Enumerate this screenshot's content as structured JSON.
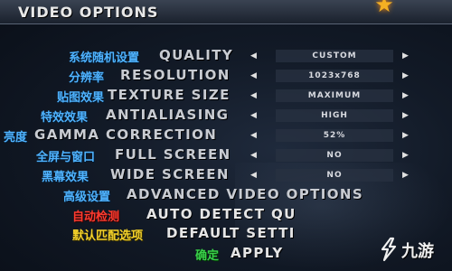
{
  "header": {
    "title": "VIDEO OPTIONS"
  },
  "options": [
    {
      "cn": "系统随机设置",
      "en": "QUALITY",
      "value": "CUSTOM"
    },
    {
      "cn": "分辨率",
      "en": "RESOLUTION",
      "value": "1023x768"
    },
    {
      "cn": "贴图效果",
      "en": "TEXTURE SIZE",
      "value": "MAXIMUM"
    },
    {
      "cn": "特效效果",
      "en": "ANTIALIASING",
      "value": "HIGH"
    },
    {
      "cn": "亮度",
      "en": "GAMMA CORRECTION",
      "value": "52%"
    },
    {
      "cn": "全屏与窗口",
      "en": "FULL SCREEN",
      "value": "NO"
    },
    {
      "cn": "黑幕效果",
      "en": "WIDE SCREEN",
      "value": "NO"
    }
  ],
  "actions": [
    {
      "cn": "高级设置",
      "en": "ADVANCED VIDEO OPTIONS"
    },
    {
      "cn": "自动检测",
      "en": "AUTO DETECT QU"
    },
    {
      "cn": "默认匹配选项",
      "en": "DEFAULT SETTI"
    },
    {
      "cn": "确定",
      "en": "APPLY"
    }
  ],
  "arrows": {
    "left": "◀",
    "right": "▶"
  },
  "star_icon": "★",
  "watermark": {
    "text": "九游",
    "icon": "jiuyou-logo-icon"
  },
  "colors": {
    "cn_label": "#4fb3ff",
    "auto_detect": "#ff3b2f",
    "default": "#f2d02a",
    "apply": "#39d04a",
    "star": "#f4b023"
  }
}
